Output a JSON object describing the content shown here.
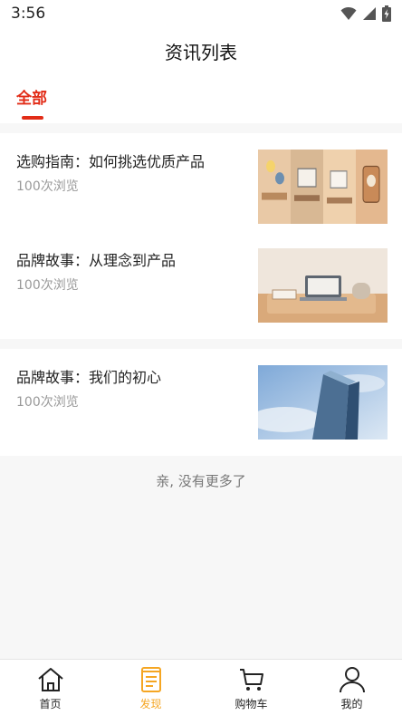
{
  "status_bar": {
    "time": "3:56"
  },
  "nav": {
    "title": "资讯列表"
  },
  "tabs": [
    {
      "label": "全部",
      "active": true
    }
  ],
  "articles": [
    {
      "title": "选购指南：如何挑选优质产品",
      "views": "100次浏览",
      "thumb": "illustration-panels"
    },
    {
      "title": "品牌故事：从理念到产品",
      "views": "100次浏览",
      "thumb": "desk-laptop"
    },
    {
      "title": "品牌故事：我们的初心",
      "views": "100次浏览",
      "thumb": "glass-building"
    }
  ],
  "empty_note": "亲, 没有更多了",
  "bottom_tabs": [
    {
      "label": "首页",
      "icon": "home-icon",
      "active": false
    },
    {
      "label": "发现",
      "icon": "discover-icon",
      "active": true
    },
    {
      "label": "购物车",
      "icon": "cart-icon",
      "active": false
    },
    {
      "label": "我的",
      "icon": "profile-icon",
      "active": false
    }
  ],
  "colors": {
    "accent_red": "#e22c17",
    "active_tab": "#f5a623"
  }
}
